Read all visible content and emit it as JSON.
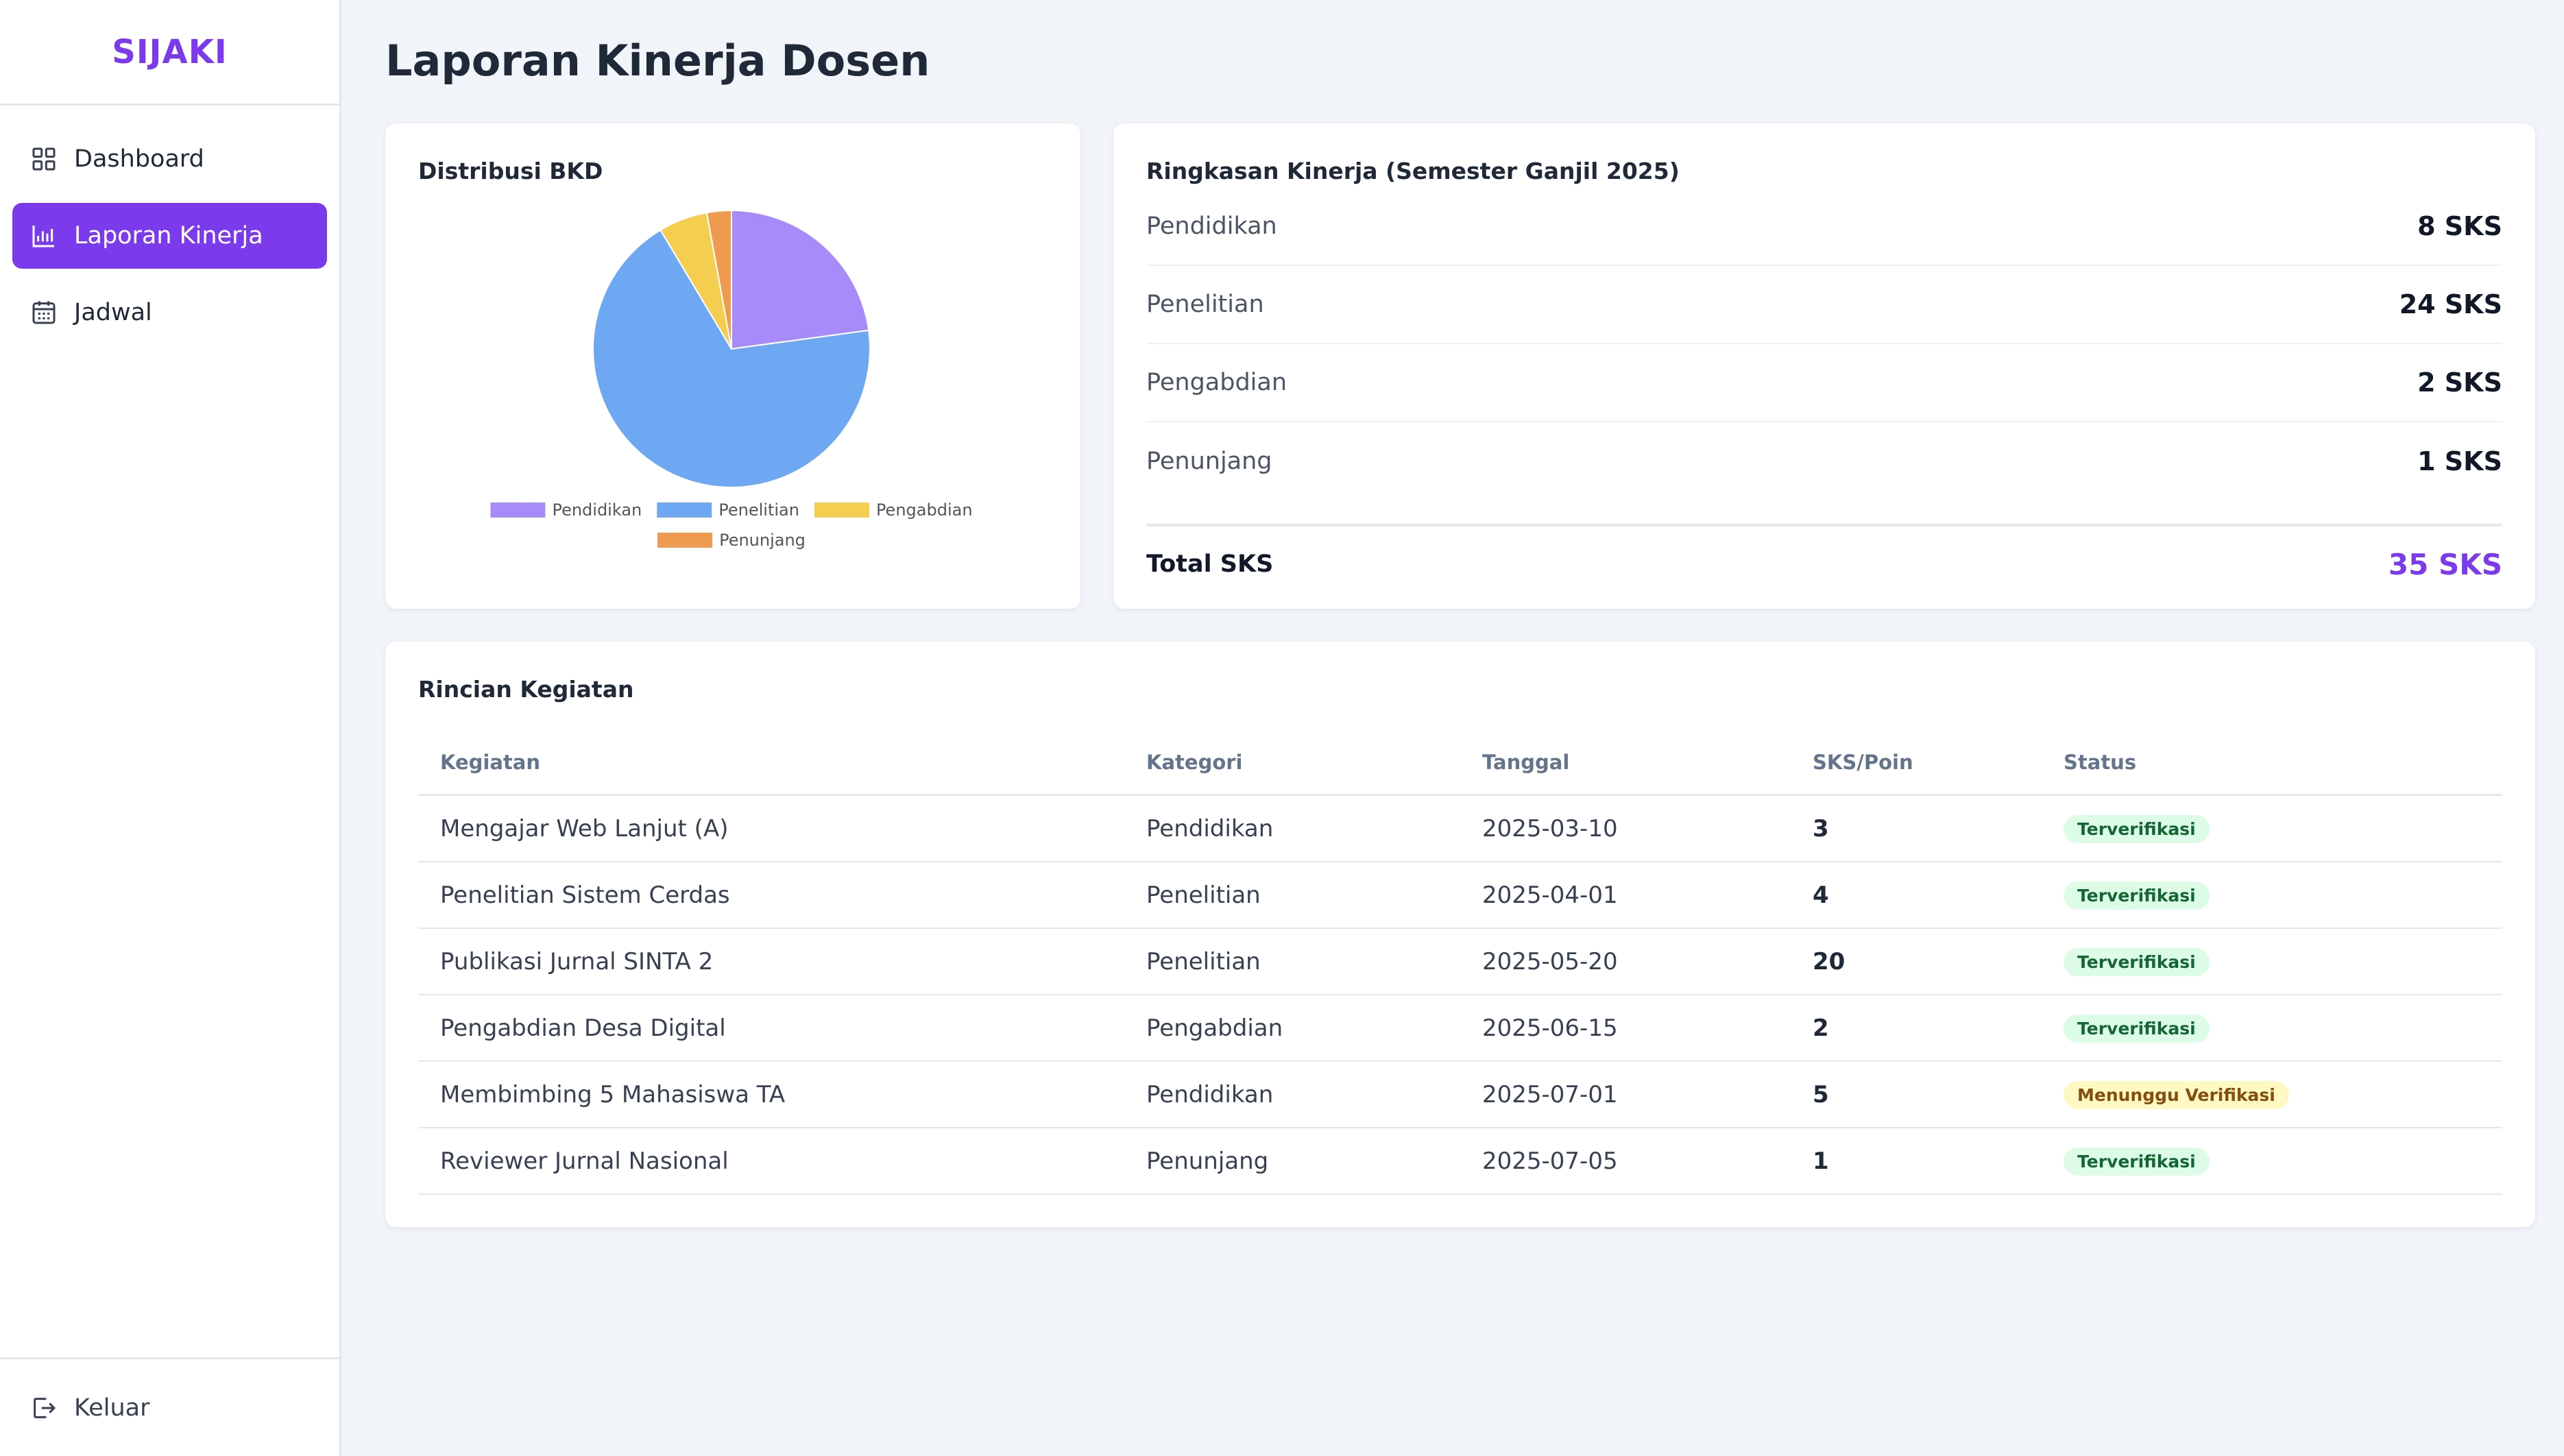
{
  "app": {
    "brand": "SIJAKI"
  },
  "sidebar": {
    "items": [
      {
        "label": "Dashboard",
        "icon": "grid-icon",
        "active": false
      },
      {
        "label": "Laporan Kinerja",
        "icon": "bar-chart-icon",
        "active": true
      },
      {
        "label": "Jadwal",
        "icon": "calendar-icon",
        "active": false
      }
    ],
    "logout_label": "Keluar",
    "logout_icon": "logout-icon"
  },
  "page": {
    "title": "Laporan Kinerja Dosen"
  },
  "chart_card": {
    "title": "Distribusi BKD"
  },
  "chart_data": {
    "type": "pie",
    "title": "",
    "categories": [
      "Pendidikan",
      "Penelitian",
      "Pengabdian",
      "Penunjang"
    ],
    "values": [
      8,
      24,
      2,
      1
    ],
    "colors": [
      "#a78bfa",
      "#6ea8f2",
      "#f5cd4f",
      "#ee9a4f"
    ],
    "legend": "bottom"
  },
  "summary": {
    "title": "Ringkasan Kinerja (Semester Ganjil 2025)",
    "rows": [
      {
        "label": "Pendidikan",
        "value": "8 SKS"
      },
      {
        "label": "Penelitian",
        "value": "24 SKS"
      },
      {
        "label": "Pengabdian",
        "value": "2 SKS"
      },
      {
        "label": "Penunjang",
        "value": "1 SKS"
      }
    ],
    "total_label": "Total SKS",
    "total_value": "35 SKS"
  },
  "details": {
    "title": "Rincian Kegiatan",
    "columns": [
      "Kegiatan",
      "Kategori",
      "Tanggal",
      "SKS/Poin",
      "Status"
    ],
    "rows": [
      {
        "kegiatan": "Mengajar Web Lanjut (A)",
        "kategori": "Pendidikan",
        "tanggal": "2025-03-10",
        "sks": "3",
        "status": "Terverifikasi"
      },
      {
        "kegiatan": "Penelitian Sistem Cerdas",
        "kategori": "Penelitian",
        "tanggal": "2025-04-01",
        "sks": "4",
        "status": "Terverifikasi"
      },
      {
        "kegiatan": "Publikasi Jurnal SINTA 2",
        "kategori": "Penelitian",
        "tanggal": "2025-05-20",
        "sks": "20",
        "status": "Terverifikasi"
      },
      {
        "kegiatan": "Pengabdian Desa Digital",
        "kategori": "Pengabdian",
        "tanggal": "2025-06-15",
        "sks": "2",
        "status": "Terverifikasi"
      },
      {
        "kegiatan": "Membimbing 5 Mahasiswa TA",
        "kategori": "Pendidikan",
        "tanggal": "2025-07-01",
        "sks": "5",
        "status": "Menunggu Verifikasi"
      },
      {
        "kegiatan": "Reviewer Jurnal Nasional",
        "kategori": "Penunjang",
        "tanggal": "2025-07-05",
        "sks": "1",
        "status": "Terverifikasi"
      }
    ]
  }
}
